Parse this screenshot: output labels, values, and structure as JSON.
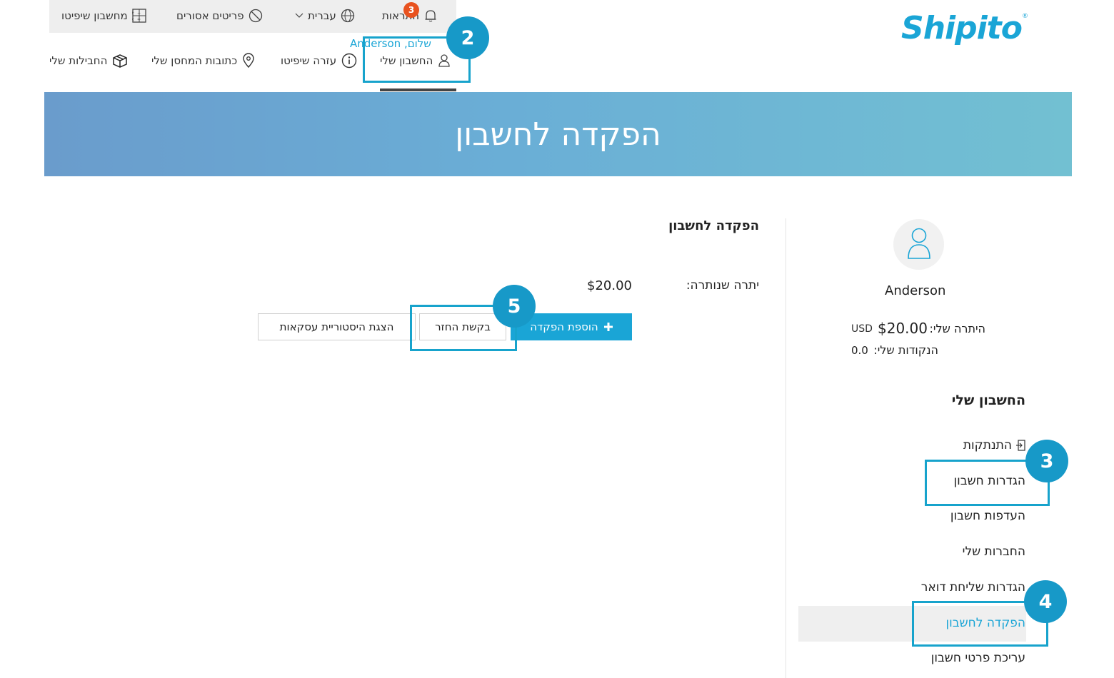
{
  "topbar": {
    "calculator_label": "מחשבון שיפיטו",
    "prohibited_label": "פריטים אסורים",
    "language_label": "עברית",
    "notifications_label": "התראות",
    "notifications_count": "3"
  },
  "logo": {
    "text": "Shipito",
    "mark": "®"
  },
  "nav": {
    "greeting": "שלום, Anderson",
    "my_account": "החשבון שלי",
    "help": "עזרה שיפיטו",
    "warehouse": "כתובות המחסן שלי",
    "packages": "החבילות שלי"
  },
  "banner": {
    "title": "הפקדה לחשבון"
  },
  "sidebar": {
    "username": "Anderson",
    "balance_label": "היתרה שלי:",
    "balance_value": "$20.00",
    "balance_currency": "USD",
    "points_label": "הנקודות שלי:",
    "points_value": "0.0",
    "section_title": "החשבון שלי",
    "menu": [
      {
        "label": "התנתקות"
      },
      {
        "label": "הגדרות חשבון"
      },
      {
        "label": "העדפות חשבון"
      },
      {
        "label": "החברות שלי"
      },
      {
        "label": "הגדרות שליחת דואר"
      },
      {
        "label": "הפקדה לחשבון",
        "active": true
      },
      {
        "label": "עריכת פרטי חשבון"
      }
    ]
  },
  "main": {
    "title": "הפקדה לחשבון",
    "balance_label": "יתרה שנותרה:",
    "balance_value": "$20.00",
    "buttons": {
      "add_deposit": "הוספת הפקדה",
      "refund": "בקשת החזר",
      "history": "הצגת היסטוריית עסקאות"
    }
  },
  "steps": [
    "2",
    "3",
    "4",
    "5"
  ],
  "colors": {
    "accent": "#1aa5d6",
    "callout": "#1799c8",
    "badge": "#e8521f"
  }
}
